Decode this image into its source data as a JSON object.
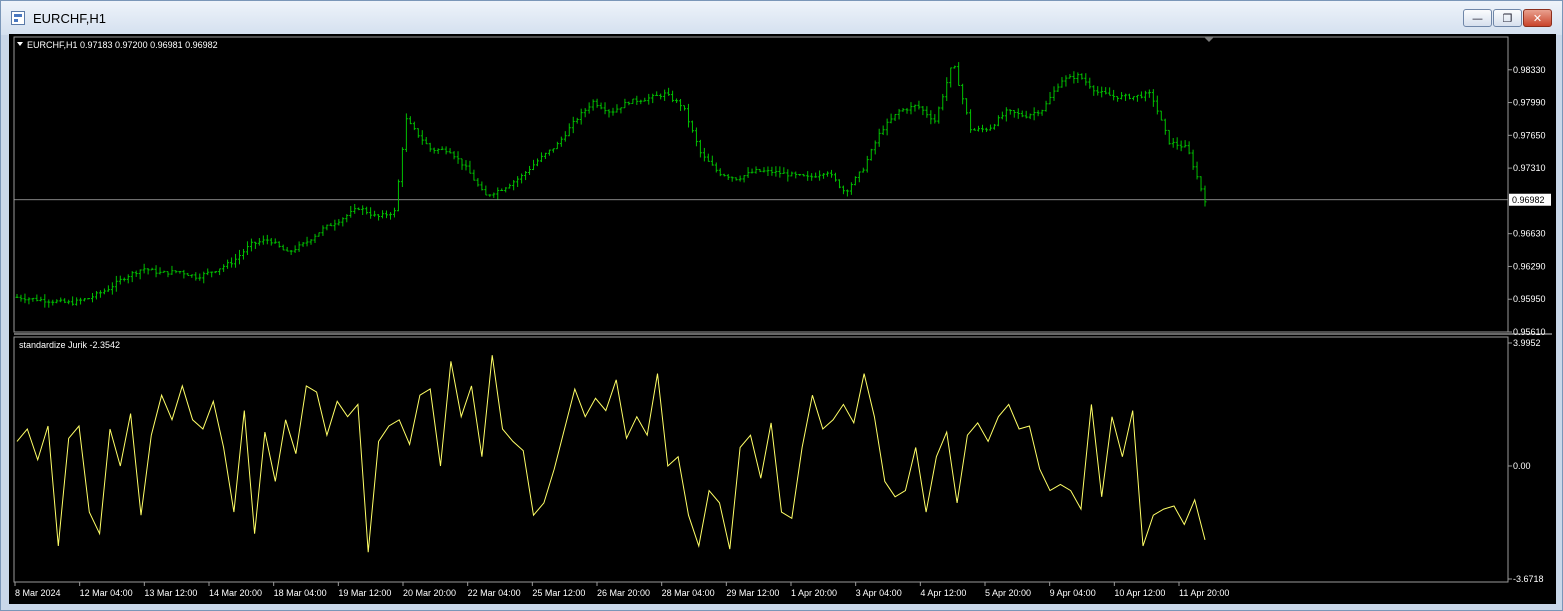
{
  "window": {
    "title": "EURCHF,H1",
    "buttons": {
      "minimize": "—",
      "restore": "❐",
      "close": "✕"
    }
  },
  "price_panel": {
    "header": "EURCHF,H1  0.97183 0.97200 0.96981 0.96982",
    "current_price_label": "0.96982",
    "current_price": 0.96982,
    "color": "#00c000"
  },
  "indicator_panel": {
    "header": "standardize Jurik -2.3542",
    "color": "#ffff66"
  },
  "chart_data": [
    {
      "type": "line",
      "title": "EURCHF,H1  0.97183 0.97200 0.96981 0.96982",
      "ylim": [
        0.9561,
        0.9867
      ],
      "y_ticks": [
        "0.98330",
        "0.97990",
        "0.97650",
        "0.97310",
        "0.96630",
        "0.96290",
        "0.95950",
        "0.95610"
      ],
      "y_tick_values": [
        0.9833,
        0.9799,
        0.9765,
        0.9731,
        0.9663,
        0.9629,
        0.9595,
        0.9561
      ],
      "series": [
        {
          "x": [
            0,
            5,
            10,
            15,
            20,
            25,
            30,
            35,
            40,
            45,
            50,
            55,
            60,
            65,
            70,
            75,
            80,
            85,
            90,
            95,
            100,
            105,
            108,
            110,
            115,
            120,
            125,
            130,
            135,
            140,
            145,
            150,
            155,
            160,
            165,
            170,
            175,
            180,
            185,
            190,
            195,
            200,
            205,
            210,
            215,
            220,
            225,
            230,
            235,
            240,
            245,
            250,
            255,
            260,
            265,
            270,
            275,
            280,
            285,
            290,
            295,
            300,
            305,
            310,
            315,
            320,
            325,
            330
          ],
          "values": [
            0.9597,
            0.9595,
            0.9593,
            0.9591,
            0.9596,
            0.9605,
            0.9618,
            0.9627,
            0.9622,
            0.9624,
            0.9618,
            0.9625,
            0.9634,
            0.9652,
            0.9657,
            0.9643,
            0.9653,
            0.9668,
            0.9678,
            0.969,
            0.968,
            0.9686,
            0.9782,
            0.9772,
            0.975,
            0.975,
            0.973,
            0.9702,
            0.971,
            0.9722,
            0.974,
            0.9755,
            0.978,
            0.98,
            0.9789,
            0.98,
            0.9803,
            0.9808,
            0.9795,
            0.9745,
            0.9726,
            0.972,
            0.9728,
            0.9727,
            0.9724,
            0.9721,
            0.9728,
            0.9706,
            0.973,
            0.977,
            0.979,
            0.9796,
            0.978,
            0.9841,
            0.977,
            0.9772,
            0.979,
            0.9785,
            0.9792,
            0.9822,
            0.9827,
            0.981,
            0.9805,
            0.9805,
            0.9808,
            0.9758,
            0.9752,
            0.9698
          ]
        }
      ]
    },
    {
      "type": "line",
      "title": "standardize Jurik -2.3542",
      "ylim": [
        -3.6718,
        3.9952
      ],
      "y_ticks": [
        "3.9952",
        "0.00",
        "-3.6718"
      ],
      "y_tick_values": [
        3.9952,
        0,
        -3.6718
      ],
      "x_ticks": [
        "8 Mar 2024",
        "12 Mar 04:00",
        "13 Mar 12:00",
        "14 Mar 20:00",
        "18 Mar 04:00",
        "19 Mar 12:00",
        "20 Mar 20:00",
        "22 Mar 04:00",
        "25 Mar 12:00",
        "26 Mar 20:00",
        "28 Mar 04:00",
        "29 Mar 12:00",
        "1 Apr 20:00",
        "3 Apr 04:00",
        "4 Apr 12:00",
        "5 Apr 20:00",
        "9 Apr 04:00",
        "10 Apr 12:00",
        "11 Apr 20:00"
      ],
      "series": [
        {
          "values": [
            0.8,
            1.2,
            0.2,
            1.3,
            -2.6,
            0.9,
            1.3,
            -1.5,
            -2.2,
            1.2,
            0.0,
            1.7,
            -1.6,
            1.0,
            2.3,
            1.5,
            2.6,
            1.5,
            1.2,
            2.1,
            0.6,
            -1.5,
            1.8,
            -2.2,
            1.1,
            -0.5,
            1.5,
            0.4,
            2.6,
            2.4,
            1.0,
            2.1,
            1.6,
            2.0,
            -2.8,
            0.8,
            1.3,
            1.5,
            0.7,
            2.3,
            2.5,
            0.0,
            3.4,
            1.6,
            2.6,
            0.3,
            3.6,
            1.2,
            0.8,
            0.5,
            -1.6,
            -1.2,
            -0.1,
            1.2,
            2.5,
            1.6,
            2.2,
            1.8,
            2.8,
            0.9,
            1.6,
            1.0,
            3.0,
            0.0,
            0.3,
            -1.6,
            -2.6,
            -0.8,
            -1.2,
            -2.7,
            0.6,
            1.0,
            -0.4,
            1.4,
            -1.5,
            -1.7,
            0.6,
            2.3,
            1.2,
            1.5,
            2.0,
            1.4,
            3.0,
            1.6,
            -0.5,
            -1.0,
            -0.8,
            0.6,
            -1.5,
            0.3,
            1.1,
            -1.2,
            1.0,
            1.4,
            0.8,
            1.6,
            2.0,
            1.2,
            1.3,
            -0.1,
            -0.8,
            -0.6,
            -0.8,
            -1.4,
            2.0,
            -1.0,
            1.6,
            0.3,
            1.8,
            -2.6,
            -1.6,
            -1.4,
            -1.3,
            -1.9,
            -1.1,
            -2.4
          ]
        }
      ]
    }
  ]
}
